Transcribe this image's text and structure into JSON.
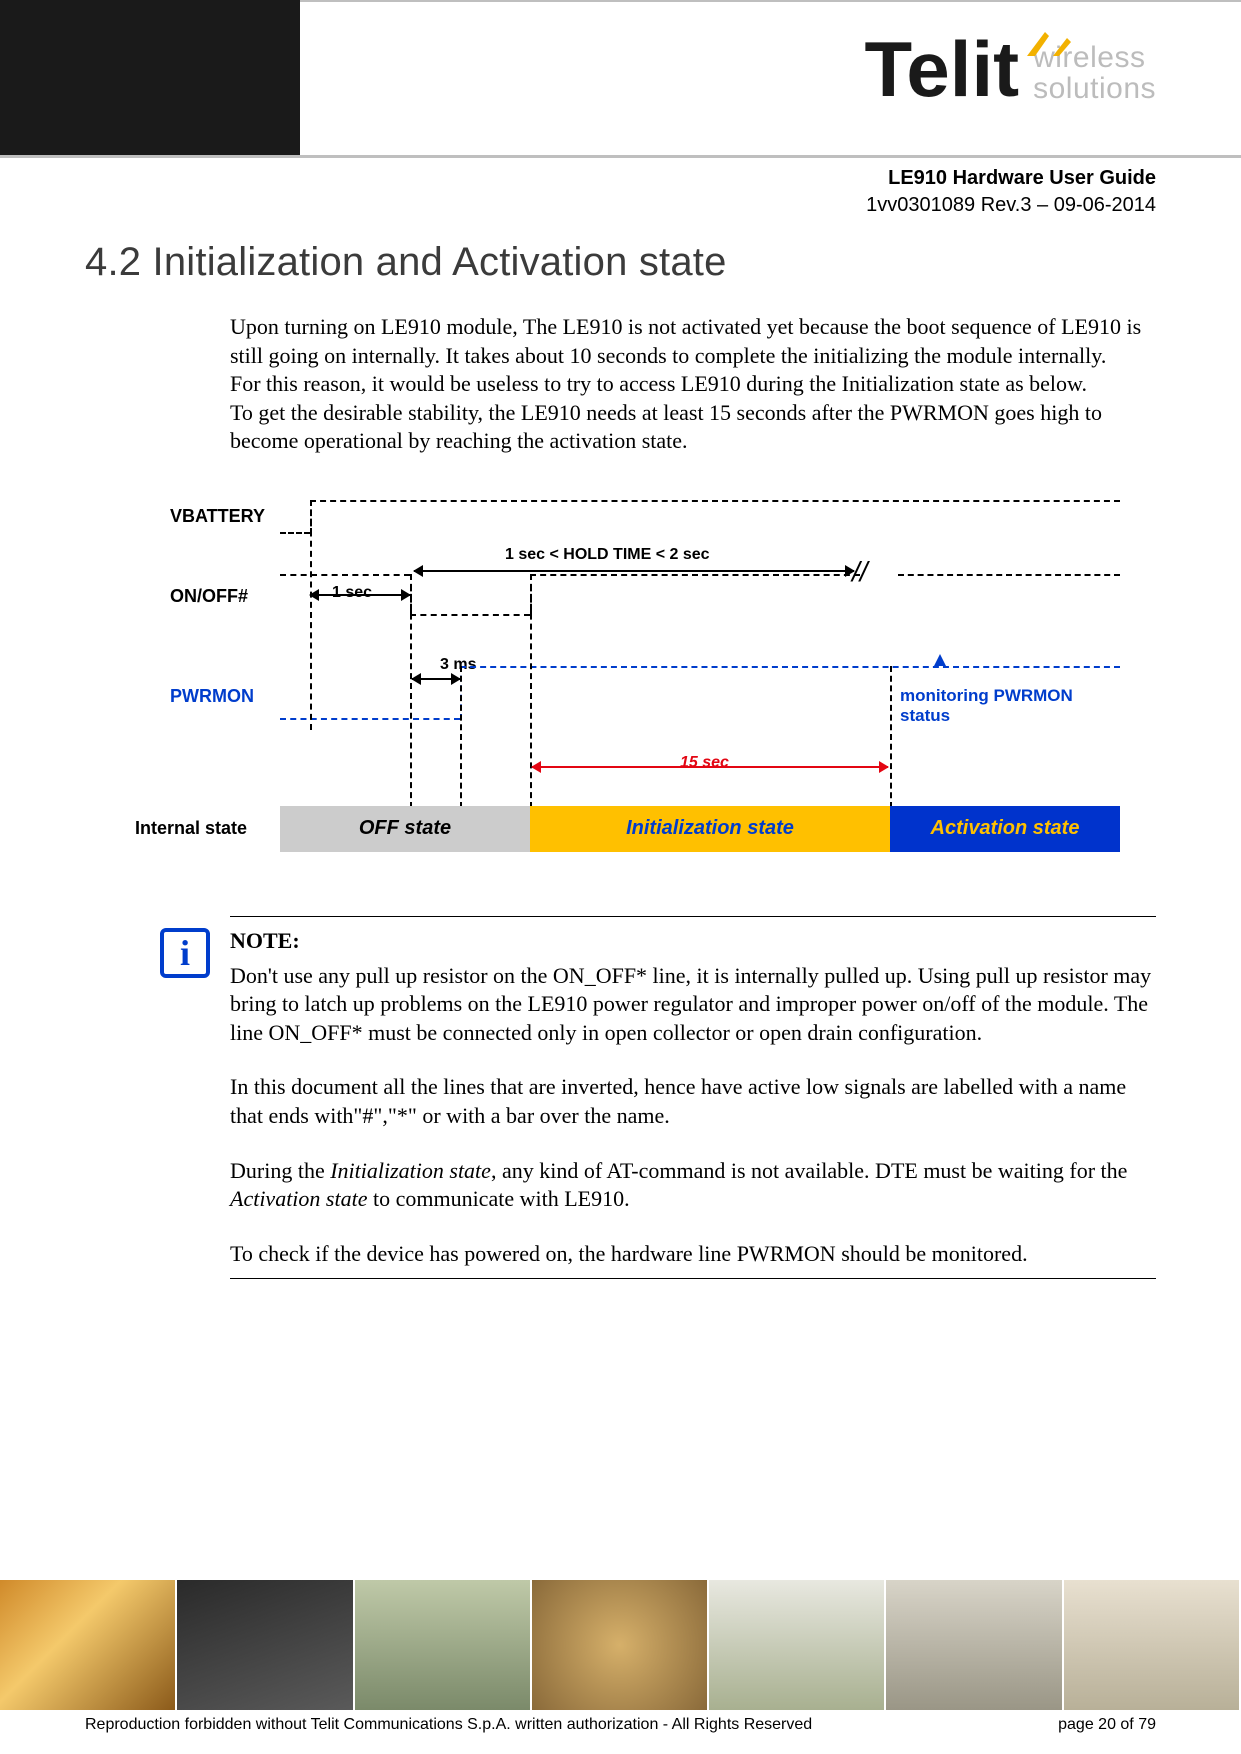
{
  "header": {
    "logo_text": "Telit",
    "logo_tag_line1": "wireless",
    "logo_tag_line2": "solutions",
    "doc_title": "LE910 Hardware User Guide",
    "doc_rev": "1vv0301089 Rev.3 – 09-06-2014"
  },
  "section": {
    "number": "4.2",
    "title": "Initialization and Activation state"
  },
  "body": {
    "p1": "Upon turning on LE910 module, The LE910 is not activated yet because the boot sequence of LE910 is still going on internally. It takes about 10 seconds to complete the initializing the module internally.",
    "p2": "For this reason, it would be useless to try to access LE910 during the Initialization state as below.",
    "p3": "To get the desirable stability, the LE910 needs at least 15 seconds after the PWRMON goes high to become operational by reaching the activation state."
  },
  "diagram": {
    "signals": {
      "vbattery": "VBATTERY",
      "onoff": "ON/OFF#",
      "pwrmon": "PWRMON",
      "internal": "Internal state"
    },
    "labels": {
      "hold": "1 sec < HOLD TIME < 2 sec",
      "one_sec": "1 sec",
      "three_ms": "3 ms",
      "fifteen_sec": "15 sec",
      "monitoring": "monitoring PWRMON status"
    },
    "states": {
      "off": "OFF state",
      "init": "Initialization state",
      "act": "Activation  state"
    }
  },
  "note": {
    "heading": "NOTE:",
    "p1": "Don't use any pull up resistor on the ON_OFF* line, it is internally pulled up. Using pull up resistor may bring to latch up problems on the LE910 power regulator and improper power on/off of the module. The line ON_OFF* must be connected only in open collector or open drain configuration.",
    "p2": "In this document all the lines that are inverted, hence have active low signals are labelled with a name that ends with\"#\",\"*\" or with a bar over the name.",
    "p3a": "During the ",
    "p3b": "Initialization state",
    "p3c": ", any kind of AT-command is not available. DTE must be waiting for the ",
    "p3d": "Activation state",
    "p3e": " to communicate with LE910.",
    "p4": "To check if the device has powered on, the hardware line PWRMON should be monitored."
  },
  "footer": {
    "copyright": "Reproduction forbidden without Telit Communications S.p.A. written authorization - All Rights Reserved",
    "page": "page 20 of 79"
  }
}
